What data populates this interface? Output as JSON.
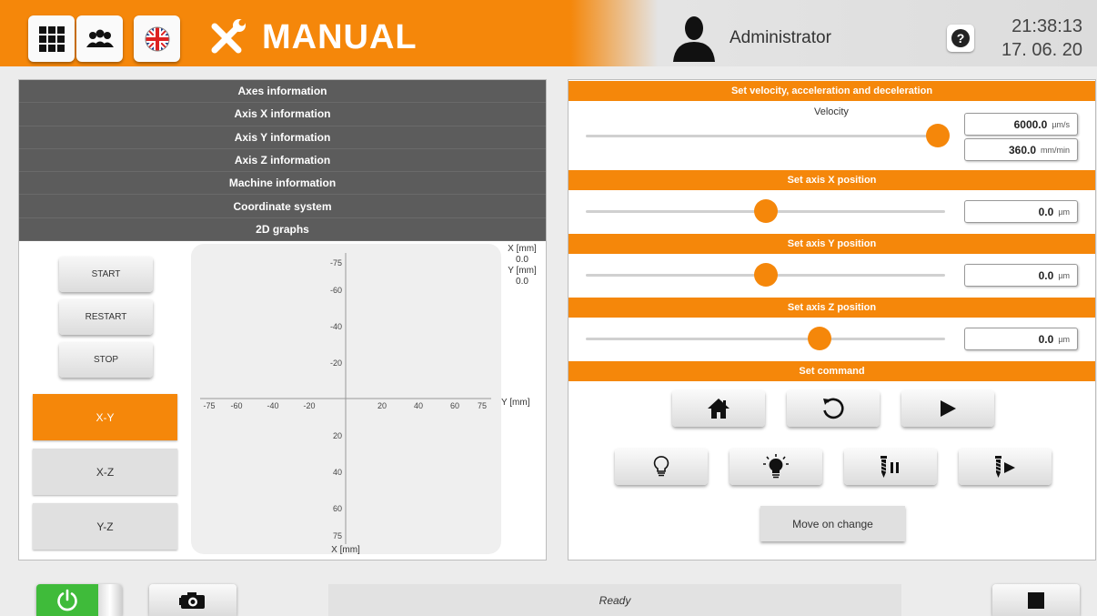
{
  "header": {
    "title": "MANUAL",
    "user": "Administrator",
    "time": "21:38:13",
    "date": "17. 06. 20",
    "accent": "#f5870a"
  },
  "left": {
    "accordion": [
      "Axes information",
      "Axis X information",
      "Axis Y information",
      "Axis Z information",
      "Machine information",
      "Coordinate system",
      "2D graphs"
    ],
    "buttons": {
      "start": "START",
      "restart": "RESTART",
      "stop": "STOP"
    },
    "views": [
      "X-Y",
      "X-Z",
      "Y-Z"
    ],
    "active_view": "X-Y",
    "readout": {
      "x_label": "X [mm]",
      "x_value": "0.0",
      "y_label": "Y [mm]",
      "y_value": "0.0"
    }
  },
  "chart_data": {
    "type": "scatter",
    "xlabel": "Y [mm]",
    "ylabel": "X [mm]",
    "xlim": [
      -75,
      75
    ],
    "ylim": [
      -75,
      75
    ],
    "x_ticks": [
      "-75",
      "-60",
      "-40",
      "-20",
      "20",
      "40",
      "60",
      "75"
    ],
    "y_ticks": [
      "-75",
      "-60",
      "-40",
      "-20",
      "20",
      "40",
      "60",
      "75"
    ],
    "series": []
  },
  "right": {
    "velocity_section": "Set velocity, acceleration and deceleration",
    "velocity_label": "Velocity",
    "velocity_value": "6000.0",
    "velocity_unit": "µm/s",
    "velocity_value2": "360.0",
    "velocity_unit2": "mm/min",
    "velocity_level": 0.98,
    "x_section": "Set axis X position",
    "x_value": "0.0",
    "x_unit": "µm",
    "x_level": 0.5,
    "y_section": "Set axis Y position",
    "y_value": "0.0",
    "y_unit": "µm",
    "y_level": 0.5,
    "z_section": "Set axis Z position",
    "z_value": "0.0",
    "z_unit": "µm",
    "z_level": 0.65,
    "command_section": "Set command",
    "command_icons": [
      "home-icon",
      "reset-icon",
      "play-icon",
      "bulb-off-icon",
      "bulb-on-icon",
      "spindle-pause-icon",
      "spindle-play-icon"
    ],
    "move_on_change": "Move on change"
  },
  "footer": {
    "status": "Ready"
  }
}
